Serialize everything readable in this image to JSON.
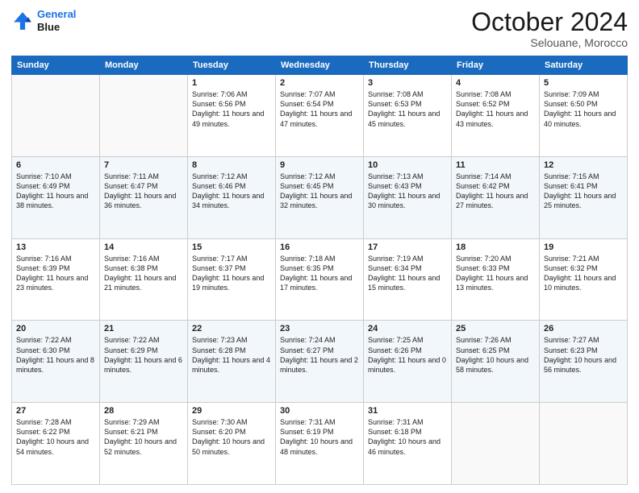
{
  "header": {
    "logo_line1": "General",
    "logo_line2": "Blue",
    "month_title": "October 2024",
    "location": "Selouane, Morocco"
  },
  "days_of_week": [
    "Sunday",
    "Monday",
    "Tuesday",
    "Wednesday",
    "Thursday",
    "Friday",
    "Saturday"
  ],
  "weeks": [
    [
      {
        "day": "",
        "sunrise": "",
        "sunset": "",
        "daylight": ""
      },
      {
        "day": "",
        "sunrise": "",
        "sunset": "",
        "daylight": ""
      },
      {
        "day": "1",
        "sunrise": "Sunrise: 7:06 AM",
        "sunset": "Sunset: 6:56 PM",
        "daylight": "Daylight: 11 hours and 49 minutes."
      },
      {
        "day": "2",
        "sunrise": "Sunrise: 7:07 AM",
        "sunset": "Sunset: 6:54 PM",
        "daylight": "Daylight: 11 hours and 47 minutes."
      },
      {
        "day": "3",
        "sunrise": "Sunrise: 7:08 AM",
        "sunset": "Sunset: 6:53 PM",
        "daylight": "Daylight: 11 hours and 45 minutes."
      },
      {
        "day": "4",
        "sunrise": "Sunrise: 7:08 AM",
        "sunset": "Sunset: 6:52 PM",
        "daylight": "Daylight: 11 hours and 43 minutes."
      },
      {
        "day": "5",
        "sunrise": "Sunrise: 7:09 AM",
        "sunset": "Sunset: 6:50 PM",
        "daylight": "Daylight: 11 hours and 40 minutes."
      }
    ],
    [
      {
        "day": "6",
        "sunrise": "Sunrise: 7:10 AM",
        "sunset": "Sunset: 6:49 PM",
        "daylight": "Daylight: 11 hours and 38 minutes."
      },
      {
        "day": "7",
        "sunrise": "Sunrise: 7:11 AM",
        "sunset": "Sunset: 6:47 PM",
        "daylight": "Daylight: 11 hours and 36 minutes."
      },
      {
        "day": "8",
        "sunrise": "Sunrise: 7:12 AM",
        "sunset": "Sunset: 6:46 PM",
        "daylight": "Daylight: 11 hours and 34 minutes."
      },
      {
        "day": "9",
        "sunrise": "Sunrise: 7:12 AM",
        "sunset": "Sunset: 6:45 PM",
        "daylight": "Daylight: 11 hours and 32 minutes."
      },
      {
        "day": "10",
        "sunrise": "Sunrise: 7:13 AM",
        "sunset": "Sunset: 6:43 PM",
        "daylight": "Daylight: 11 hours and 30 minutes."
      },
      {
        "day": "11",
        "sunrise": "Sunrise: 7:14 AM",
        "sunset": "Sunset: 6:42 PM",
        "daylight": "Daylight: 11 hours and 27 minutes."
      },
      {
        "day": "12",
        "sunrise": "Sunrise: 7:15 AM",
        "sunset": "Sunset: 6:41 PM",
        "daylight": "Daylight: 11 hours and 25 minutes."
      }
    ],
    [
      {
        "day": "13",
        "sunrise": "Sunrise: 7:16 AM",
        "sunset": "Sunset: 6:39 PM",
        "daylight": "Daylight: 11 hours and 23 minutes."
      },
      {
        "day": "14",
        "sunrise": "Sunrise: 7:16 AM",
        "sunset": "Sunset: 6:38 PM",
        "daylight": "Daylight: 11 hours and 21 minutes."
      },
      {
        "day": "15",
        "sunrise": "Sunrise: 7:17 AM",
        "sunset": "Sunset: 6:37 PM",
        "daylight": "Daylight: 11 hours and 19 minutes."
      },
      {
        "day": "16",
        "sunrise": "Sunrise: 7:18 AM",
        "sunset": "Sunset: 6:35 PM",
        "daylight": "Daylight: 11 hours and 17 minutes."
      },
      {
        "day": "17",
        "sunrise": "Sunrise: 7:19 AM",
        "sunset": "Sunset: 6:34 PM",
        "daylight": "Daylight: 11 hours and 15 minutes."
      },
      {
        "day": "18",
        "sunrise": "Sunrise: 7:20 AM",
        "sunset": "Sunset: 6:33 PM",
        "daylight": "Daylight: 11 hours and 13 minutes."
      },
      {
        "day": "19",
        "sunrise": "Sunrise: 7:21 AM",
        "sunset": "Sunset: 6:32 PM",
        "daylight": "Daylight: 11 hours and 10 minutes."
      }
    ],
    [
      {
        "day": "20",
        "sunrise": "Sunrise: 7:22 AM",
        "sunset": "Sunset: 6:30 PM",
        "daylight": "Daylight: 11 hours and 8 minutes."
      },
      {
        "day": "21",
        "sunrise": "Sunrise: 7:22 AM",
        "sunset": "Sunset: 6:29 PM",
        "daylight": "Daylight: 11 hours and 6 minutes."
      },
      {
        "day": "22",
        "sunrise": "Sunrise: 7:23 AM",
        "sunset": "Sunset: 6:28 PM",
        "daylight": "Daylight: 11 hours and 4 minutes."
      },
      {
        "day": "23",
        "sunrise": "Sunrise: 7:24 AM",
        "sunset": "Sunset: 6:27 PM",
        "daylight": "Daylight: 11 hours and 2 minutes."
      },
      {
        "day": "24",
        "sunrise": "Sunrise: 7:25 AM",
        "sunset": "Sunset: 6:26 PM",
        "daylight": "Daylight: 11 hours and 0 minutes."
      },
      {
        "day": "25",
        "sunrise": "Sunrise: 7:26 AM",
        "sunset": "Sunset: 6:25 PM",
        "daylight": "Daylight: 10 hours and 58 minutes."
      },
      {
        "day": "26",
        "sunrise": "Sunrise: 7:27 AM",
        "sunset": "Sunset: 6:23 PM",
        "daylight": "Daylight: 10 hours and 56 minutes."
      }
    ],
    [
      {
        "day": "27",
        "sunrise": "Sunrise: 7:28 AM",
        "sunset": "Sunset: 6:22 PM",
        "daylight": "Daylight: 10 hours and 54 minutes."
      },
      {
        "day": "28",
        "sunrise": "Sunrise: 7:29 AM",
        "sunset": "Sunset: 6:21 PM",
        "daylight": "Daylight: 10 hours and 52 minutes."
      },
      {
        "day": "29",
        "sunrise": "Sunrise: 7:30 AM",
        "sunset": "Sunset: 6:20 PM",
        "daylight": "Daylight: 10 hours and 50 minutes."
      },
      {
        "day": "30",
        "sunrise": "Sunrise: 7:31 AM",
        "sunset": "Sunset: 6:19 PM",
        "daylight": "Daylight: 10 hours and 48 minutes."
      },
      {
        "day": "31",
        "sunrise": "Sunrise: 7:31 AM",
        "sunset": "Sunset: 6:18 PM",
        "daylight": "Daylight: 10 hours and 46 minutes."
      },
      {
        "day": "",
        "sunrise": "",
        "sunset": "",
        "daylight": ""
      },
      {
        "day": "",
        "sunrise": "",
        "sunset": "",
        "daylight": ""
      }
    ]
  ]
}
